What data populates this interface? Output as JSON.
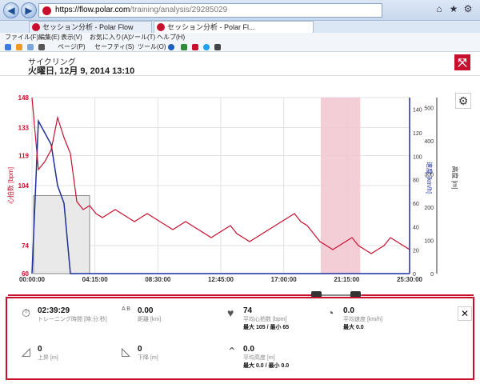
{
  "browser": {
    "url_host": "https://flow.polar.com",
    "url_path": "/training/analysis/29285029",
    "tabs": [
      {
        "label": "セッション分析 - Polar Flow"
      },
      {
        "label": "セッション分析 - Polar Fl..."
      }
    ],
    "menu": [
      "ファイル(F)",
      "編集(E)",
      "表示(V)",
      "お気に入り(A)",
      "ツール(T)",
      "ヘルプ(H)"
    ],
    "commands": [
      "ページ(P)",
      "セーフティ(S)",
      "ツール(O)"
    ]
  },
  "session": {
    "sport": "サイクリング",
    "date": "火曜日, 12月 9, 2014 13:10"
  },
  "chart_data": {
    "type": "line",
    "x_ticks": [
      "00:00:00",
      "04:15:00",
      "08:30:00",
      "12:45:00",
      "17:00:00",
      "21:15:00",
      "25:30:00"
    ],
    "y_left": {
      "label": "心拍数 [bpm]",
      "ticks": [
        "60",
        "74",
        "104",
        "119",
        "133",
        "148"
      ],
      "range": [
        60,
        148
      ]
    },
    "y_mid": {
      "label": "速度 [km/h]",
      "ticks": [
        "0",
        "20",
        "40",
        "60",
        "80",
        "100",
        "120",
        "140"
      ],
      "range": [
        0,
        150
      ]
    },
    "y_right": {
      "label": "高度 [m]",
      "ticks": [
        "0",
        "100",
        "200",
        "300",
        "400",
        "500"
      ],
      "range": [
        0,
        530
      ]
    },
    "highlight_range": [
      "19:30:00",
      "22:10:00"
    ],
    "series": [
      {
        "color": "#c8102e",
        "axis": "left",
        "values": [
          148,
          112,
          116,
          122,
          138,
          128,
          120,
          96,
          92,
          94,
          90,
          88,
          90,
          92,
          90,
          88,
          86,
          88,
          90,
          88,
          86,
          84,
          82,
          84,
          86,
          84,
          82,
          80,
          78,
          80,
          82,
          84,
          80,
          78,
          76,
          78,
          80,
          82,
          84,
          86,
          88,
          90,
          86,
          84,
          80,
          76,
          74,
          72,
          74,
          76,
          78,
          74,
          72,
          70,
          72,
          74,
          78,
          76,
          74,
          72
        ]
      },
      {
        "color": "#1f2f9f",
        "axis": "mid",
        "values": [
          0,
          130,
          120,
          110,
          75,
          60,
          0,
          0,
          0,
          0,
          0,
          0,
          0,
          0,
          0,
          0,
          0,
          0,
          0,
          0,
          0,
          0,
          0,
          0,
          0,
          0,
          0,
          0,
          0,
          0,
          0,
          0,
          0,
          0,
          0,
          0,
          0,
          0,
          0,
          0,
          0,
          0,
          0,
          0,
          0,
          0,
          0,
          0,
          0,
          0,
          0,
          0,
          0,
          0,
          0,
          0,
          0,
          0,
          0,
          0
        ]
      }
    ]
  },
  "summary": {
    "duration": {
      "value": "02:39:29",
      "label": "トレーニング時間 [時:分:秒]"
    },
    "distance": {
      "ab": "A  B",
      "value": "0.00",
      "label": "距離 [km]"
    },
    "heart_rate": {
      "value": "74",
      "label": "平均心拍数 [bpm]",
      "sub": "最大 105 / 最小 65"
    },
    "speed": {
      "value": "0.0",
      "label": "平均速度 [km/h]",
      "sub": "最大 0.0"
    },
    "ascent": {
      "value": "0",
      "label": "上昇 [m]"
    },
    "descent": {
      "value": "0",
      "label": "下降 [m]"
    },
    "altitude": {
      "value": "0.0",
      "label": "平均高度 [m]",
      "sub": "最大 0.0 / 最小 0.0"
    }
  }
}
